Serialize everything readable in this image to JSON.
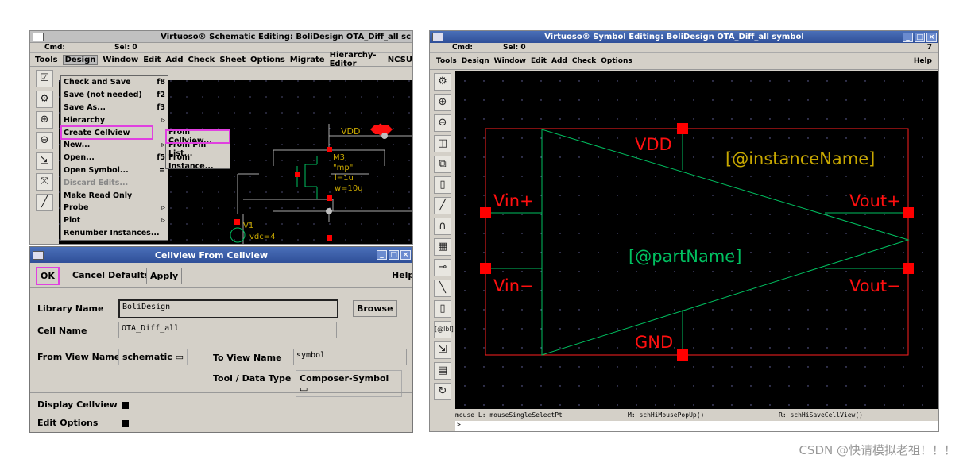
{
  "left_window": {
    "title": "Virtuoso® Schematic Editing: BoliDesign OTA_Diff_all sc",
    "cmd_label": "Cmd:",
    "sel_label": "Sel: 0",
    "menus": [
      "Tools",
      "Design",
      "Window",
      "Edit",
      "Add",
      "Check",
      "Sheet",
      "Options",
      "Migrate",
      "Hierarchy-Editor",
      "NCSU"
    ],
    "design_menu": [
      {
        "label": "Check and Save",
        "key": "f8"
      },
      {
        "label": "Save (not needed)",
        "key": "f2"
      },
      {
        "label": "Save As...",
        "key": "f3"
      },
      {
        "label": "Hierarchy",
        "key": ""
      },
      {
        "label": "Create Cellview",
        "key": ""
      },
      {
        "label": "New...",
        "key": ""
      },
      {
        "label": "Open...",
        "key": "f5"
      },
      {
        "label": "Open Symbol...",
        "key": "="
      },
      {
        "label": "Discard Edits...",
        "key": ""
      },
      {
        "label": "Make Read Only",
        "key": ""
      },
      {
        "label": "Probe",
        "key": ""
      },
      {
        "label": "Plot",
        "key": ""
      },
      {
        "label": "Renumber Instances...",
        "key": ""
      }
    ],
    "create_submenu": [
      "From Cellview...",
      "From Pin List...",
      "From Instance..."
    ],
    "schematic": {
      "vdd": "VDD",
      "m3": "M3",
      "mp": "\"mp\"",
      "l": "l=1u",
      "w": "w=10u",
      "v1": "V1",
      "vdc": "vdc=4"
    }
  },
  "dialog": {
    "title": "Cellview From Cellview",
    "buttons": {
      "ok": "OK",
      "cancel": "Cancel",
      "defaults": "Defaults",
      "apply": "Apply",
      "help": "Help"
    },
    "library_label": "Library Name",
    "library_value": "BoliDesign",
    "browse": "Browse",
    "cell_label": "Cell Name",
    "cell_value": "OTA_Diff_all",
    "from_view_label": "From View Name",
    "from_view_value": "schematic",
    "to_view_label": "To View Name",
    "to_view_value": "symbol",
    "tool_label": "Tool / Data Type",
    "tool_value": "Composer-Symbol",
    "display_label": "Display Cellview",
    "edit_options_label": "Edit Options"
  },
  "right_window": {
    "title": "Virtuoso® Symbol Editing: BoliDesign OTA_Diff_all symbol",
    "cmd_label": "Cmd:",
    "sel_label": "Sel: 0",
    "count": "7",
    "menus": [
      "Tools",
      "Design",
      "Window",
      "Edit",
      "Add",
      "Check",
      "Options"
    ],
    "help": "Help",
    "symbol": {
      "vdd": "VDD",
      "gnd": "GND",
      "vin_plus": "Vin+",
      "vin_minus": "Vin−",
      "vout_plus": "Vout+",
      "vout_minus": "Vout−",
      "instance_name": "[@instanceName]",
      "part_name": "[@partName]"
    },
    "mouse_l": "mouse L: mouseSingleSelectPt",
    "mouse_m": "M: schHiMousePopUp()",
    "mouse_r": "R: schHiSaveCellView()",
    "prompt": ">"
  },
  "watermark": "CSDN @快请模拟老祖！！！",
  "colors": {
    "highlight": "#e040e0",
    "pin": "#ff0000",
    "wire": "#00c060",
    "label": "#c8a800"
  }
}
